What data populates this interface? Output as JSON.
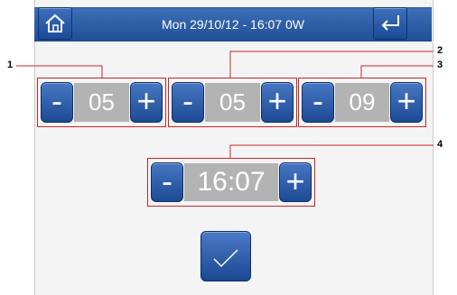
{
  "header": {
    "title": "Mon 29/10/12 - 16:07   0W"
  },
  "icons": {
    "home": "home-icon",
    "back": "return-arrow-icon",
    "confirm": "checkmark-icon"
  },
  "steppers": [
    {
      "callout": "1",
      "minus": "-",
      "value": "05",
      "plus": "+"
    },
    {
      "callout": "2",
      "minus": "-",
      "value": "05",
      "plus": "+"
    },
    {
      "callout": "3",
      "minus": "-",
      "value": "09",
      "plus": "+"
    },
    {
      "callout": "4",
      "minus": "-",
      "value": "16:07",
      "plus": "+"
    }
  ],
  "colors": {
    "header": "#2a5aa3",
    "callout_box": "#c9262a",
    "value_bg": "#b3b3b3"
  }
}
